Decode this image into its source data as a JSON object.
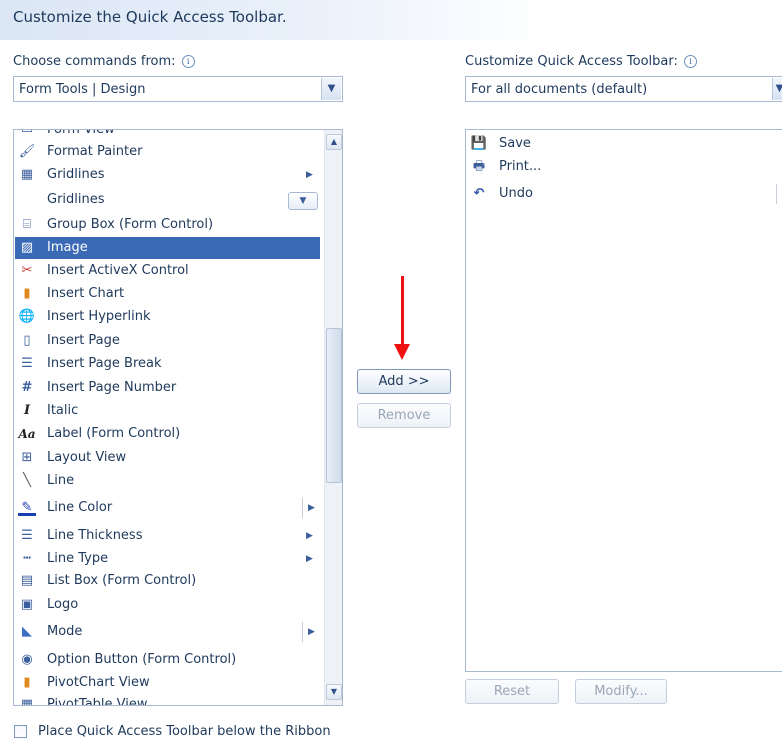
{
  "dialog": {
    "title": "Customize the Quick Access Toolbar."
  },
  "left": {
    "label": "Choose commands from:",
    "info": "i",
    "combo_value": "Form Tools | Design",
    "items": [
      {
        "label": "Form View",
        "icon": "form-view-icon",
        "glyph": "▭"
      },
      {
        "label": "Format Painter",
        "icon": "format-painter-icon",
        "glyph": "🖌"
      },
      {
        "label": "Gridlines",
        "icon": "gridlines-icon",
        "glyph": "▦",
        "submenu": true
      },
      {
        "label": "Gridlines",
        "icon": "",
        "glyph": "",
        "gallery": true
      },
      {
        "label": "Group Box (Form Control)",
        "icon": "group-box-icon",
        "glyph": "⌸"
      },
      {
        "label": "Image",
        "icon": "image-icon",
        "glyph": "▨",
        "selected": true
      },
      {
        "label": "Insert ActiveX Control",
        "icon": "activex-icon",
        "glyph": "✂"
      },
      {
        "label": "Insert Chart",
        "icon": "chart-icon",
        "glyph": "▮"
      },
      {
        "label": "Insert Hyperlink",
        "icon": "hyperlink-icon",
        "glyph": "🌐"
      },
      {
        "label": "Insert Page",
        "icon": "insert-page-icon",
        "glyph": "▯"
      },
      {
        "label": "Insert Page Break",
        "icon": "page-break-icon",
        "glyph": "☰"
      },
      {
        "label": "Insert Page Number",
        "icon": "page-number-icon",
        "glyph": "#"
      },
      {
        "label": "Italic",
        "icon": "italic-icon",
        "glyph": "I"
      },
      {
        "label": "Label (Form Control)",
        "icon": "label-icon",
        "glyph": "Aa"
      },
      {
        "label": "Layout View",
        "icon": "layout-view-icon",
        "glyph": "⊞"
      },
      {
        "label": "Line",
        "icon": "line-icon",
        "glyph": "╲"
      },
      {
        "label": "Line Color",
        "icon": "line-color-icon",
        "glyph": "✎",
        "split": true
      },
      {
        "label": "Line Thickness",
        "icon": "line-thickness-icon",
        "glyph": "☰",
        "submenu": true
      },
      {
        "label": "Line Type",
        "icon": "line-type-icon",
        "glyph": "┅",
        "submenu": true
      },
      {
        "label": "List Box (Form Control)",
        "icon": "list-box-icon",
        "glyph": "▤"
      },
      {
        "label": "Logo",
        "icon": "logo-icon",
        "glyph": "▣"
      },
      {
        "label": "Mode",
        "icon": "mode-icon",
        "glyph": "◣",
        "split": true
      },
      {
        "label": "Option Button (Form Control)",
        "icon": "option-button-icon",
        "glyph": "◉"
      },
      {
        "label": "PivotChart View",
        "icon": "pivotchart-icon",
        "glyph": "▮"
      },
      {
        "label": "PivotTable View",
        "icon": "pivottable-icon",
        "glyph": "▦"
      }
    ]
  },
  "right": {
    "label": "Customize Quick Access Toolbar:",
    "info": "i",
    "combo_value": "For all documents (default)",
    "items": [
      {
        "label": "Save",
        "icon": "save-icon",
        "glyph": "💾"
      },
      {
        "label": "Print...",
        "icon": "print-icon",
        "glyph": "🖶"
      },
      {
        "label": "Undo",
        "icon": "undo-icon",
        "glyph": "↶"
      }
    ]
  },
  "buttons": {
    "add": "Add >>",
    "remove": "Remove",
    "reset": "Reset",
    "modify": "Modify..."
  },
  "footer": {
    "checkbox_label": "Place Quick Access Toolbar below the Ribbon",
    "checked": false
  },
  "colors": {
    "accent": "#3a6ab5",
    "annotation_arrow": "#e11111"
  }
}
